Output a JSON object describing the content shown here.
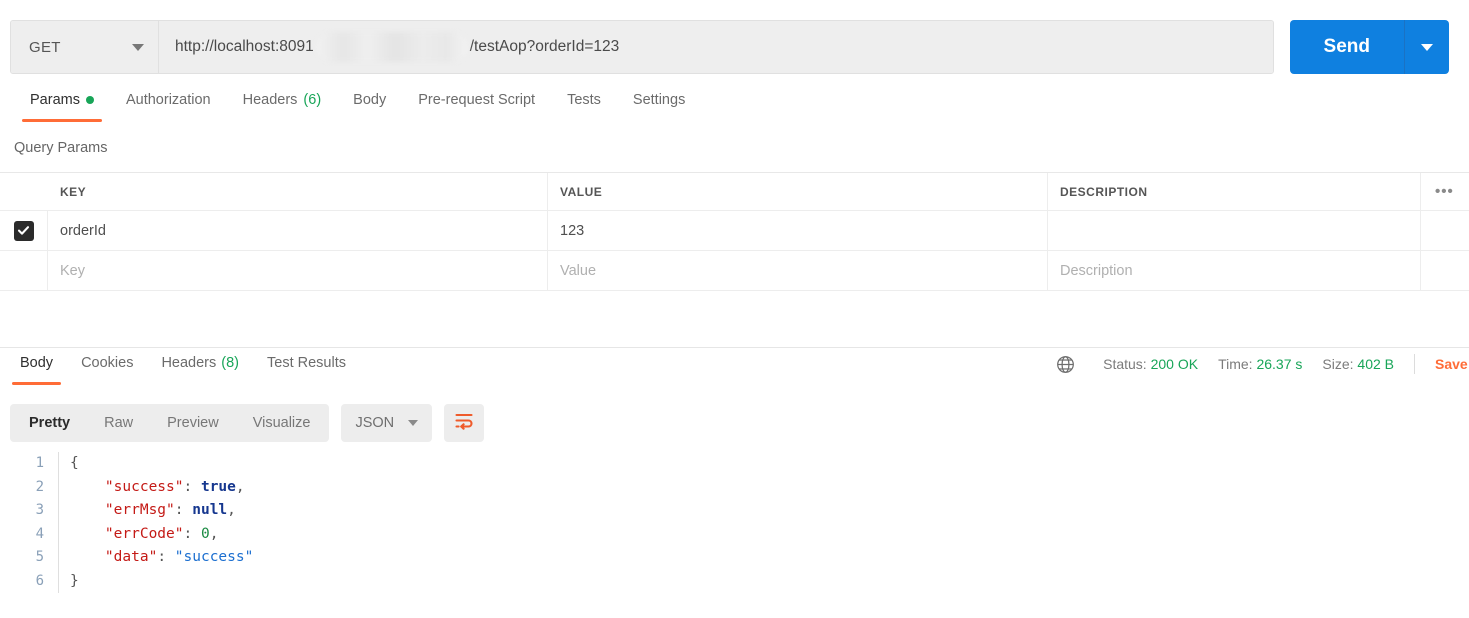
{
  "request": {
    "method": "GET",
    "method_caret_icon": "chevron-down-icon",
    "url_prefix": "http://localhost:8091",
    "url_suffix": "/testAop?orderId=123",
    "url_redacted": "",
    "send_label": "Send",
    "send_caret_icon": "chevron-down-icon"
  },
  "request_tabs": [
    {
      "label": "Params",
      "badge": "",
      "indicator": "dot",
      "active": true
    },
    {
      "label": "Authorization",
      "badge": "",
      "indicator": "",
      "active": false
    },
    {
      "label": "Headers",
      "badge": "(6)",
      "indicator": "",
      "active": false
    },
    {
      "label": "Body",
      "badge": "",
      "indicator": "",
      "active": false
    },
    {
      "label": "Pre-request Script",
      "badge": "",
      "indicator": "",
      "active": false
    },
    {
      "label": "Tests",
      "badge": "",
      "indicator": "",
      "active": false
    },
    {
      "label": "Settings",
      "badge": "",
      "indicator": "",
      "active": false
    }
  ],
  "query_params": {
    "title": "Query Params",
    "columns": {
      "key": "KEY",
      "value": "VALUE",
      "description": "DESCRIPTION"
    },
    "more_icon": "ellipsis-icon",
    "rows": [
      {
        "checked": true,
        "key": "orderId",
        "value": "123",
        "description": ""
      }
    ],
    "placeholder_row": {
      "key": "Key",
      "value": "Value",
      "description": "Description"
    }
  },
  "response_tabs": [
    {
      "label": "Body",
      "badge": "",
      "active": true
    },
    {
      "label": "Cookies",
      "badge": "",
      "active": false
    },
    {
      "label": "Headers",
      "badge": "(8)",
      "active": false
    },
    {
      "label": "Test Results",
      "badge": "",
      "active": false
    }
  ],
  "response_meta": {
    "globe_icon": "globe-icon",
    "status_label": "Status:",
    "status_value": "200 OK",
    "time_label": "Time:",
    "time_value": "26.37 s",
    "size_label": "Size:",
    "size_value": "402 B",
    "save_label": "Save"
  },
  "body_toolbar": {
    "views": [
      {
        "label": "Pretty",
        "active": true
      },
      {
        "label": "Raw",
        "active": false
      },
      {
        "label": "Preview",
        "active": false
      },
      {
        "label": "Visualize",
        "active": false
      }
    ],
    "format": "JSON",
    "format_caret_icon": "chevron-down-icon",
    "wrap_icon": "word-wrap-icon"
  },
  "response_body": {
    "language": "json",
    "lines": [
      {
        "no": "1",
        "tokens": [
          {
            "t": "{",
            "c": "tok-brace"
          }
        ]
      },
      {
        "no": "2",
        "tokens": [
          {
            "t": "    ",
            "c": "tok-punct"
          },
          {
            "t": "\"success\"",
            "c": "tok-key"
          },
          {
            "t": ": ",
            "c": "tok-punct"
          },
          {
            "t": "true",
            "c": "tok-bool"
          },
          {
            "t": ",",
            "c": "tok-punct"
          }
        ]
      },
      {
        "no": "3",
        "tokens": [
          {
            "t": "    ",
            "c": "tok-punct"
          },
          {
            "t": "\"errMsg\"",
            "c": "tok-key"
          },
          {
            "t": ": ",
            "c": "tok-punct"
          },
          {
            "t": "null",
            "c": "tok-bool"
          },
          {
            "t": ",",
            "c": "tok-punct"
          }
        ]
      },
      {
        "no": "4",
        "tokens": [
          {
            "t": "    ",
            "c": "tok-punct"
          },
          {
            "t": "\"errCode\"",
            "c": "tok-key"
          },
          {
            "t": ": ",
            "c": "tok-punct"
          },
          {
            "t": "0",
            "c": "tok-num"
          },
          {
            "t": ",",
            "c": "tok-punct"
          }
        ]
      },
      {
        "no": "5",
        "tokens": [
          {
            "t": "    ",
            "c": "tok-punct"
          },
          {
            "t": "\"data\"",
            "c": "tok-key"
          },
          {
            "t": ": ",
            "c": "tok-punct"
          },
          {
            "t": "\"success\"",
            "c": "tok-str"
          }
        ]
      },
      {
        "no": "6",
        "tokens": [
          {
            "t": "}",
            "c": "tok-brace"
          }
        ]
      }
    ]
  },
  "colors": {
    "accent_orange": "#ff6c37",
    "send_blue": "#0f80e0",
    "status_green": "#18a558",
    "json_key": "#c41a16",
    "json_string": "#1c6fd0",
    "json_bool": "#16378f",
    "json_number": "#1a8a42"
  }
}
